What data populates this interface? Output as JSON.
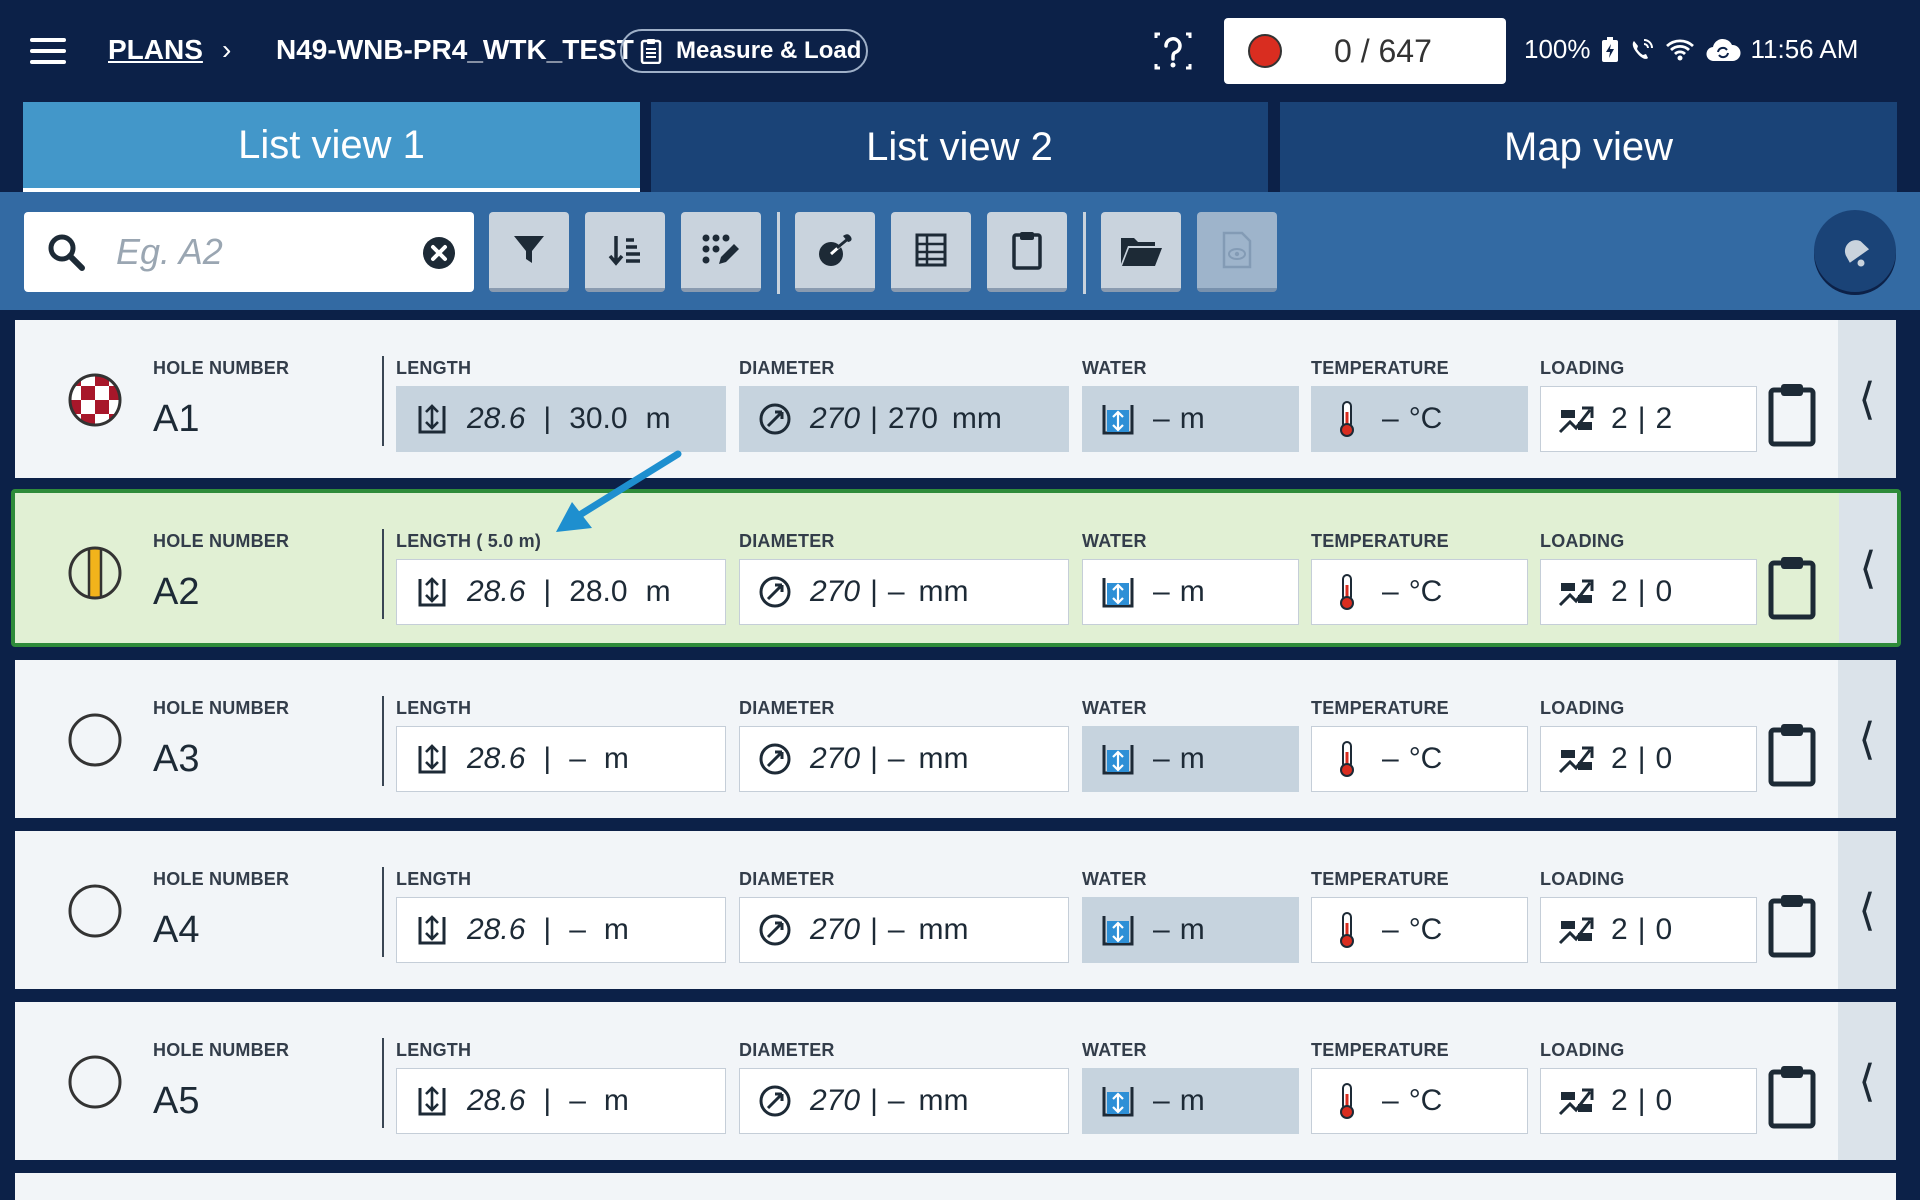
{
  "header": {
    "breadcrumb_root": "PLANS",
    "breadcrumb_sep": "›",
    "plan_name": "N49-WNB-PR4_WTK_TEST",
    "mode_label": "Measure & Load",
    "counter": "0 / 647",
    "battery": "100%",
    "time": "11:56 AM"
  },
  "tabs": [
    {
      "label": "List view 1",
      "active": true
    },
    {
      "label": "List view 2",
      "active": false
    },
    {
      "label": "Map view",
      "active": false
    }
  ],
  "search": {
    "placeholder": "Eg. A2",
    "value": ""
  },
  "toolbar_icons": [
    "filter-icon",
    "sort-icon",
    "grid-edit-icon",
    "stemming-icon",
    "table-icon",
    "clipboard-icon",
    "folder-icon",
    "document-view-icon",
    "bell-icon"
  ],
  "labels": {
    "hole_number": "HOLE NUMBER",
    "length": "LENGTH",
    "diameter": "DIAMETER",
    "water": "WATER",
    "temperature": "TEMPERATURE",
    "loading": "LOADING"
  },
  "rows": [
    {
      "status": "checkered",
      "hole": "A1",
      "length_label": "LENGTH",
      "length_plan": "28.6",
      "length_meas": "30.0",
      "length_unit": "m",
      "diam_plan": "270",
      "diam_meas": "270",
      "diam_unit": "mm",
      "water": "–",
      "water_unit": "m",
      "temp": "–",
      "temp_unit": "°C",
      "load_plan": "2",
      "load_meas": "2"
    },
    {
      "status": "half-yellow",
      "hole": "A2",
      "length_label": "LENGTH ( 5.0 m)",
      "length_plan": "28.6",
      "length_meas": "28.0",
      "length_unit": "m",
      "diam_plan": "270",
      "diam_meas": "–",
      "diam_unit": "mm",
      "water": "–",
      "water_unit": "m",
      "temp": "–",
      "temp_unit": "°C",
      "load_plan": "2",
      "load_meas": "0"
    },
    {
      "status": "empty",
      "hole": "A3",
      "length_label": "LENGTH",
      "length_plan": "28.6",
      "length_meas": "–",
      "length_unit": "m",
      "diam_plan": "270",
      "diam_meas": "–",
      "diam_unit": "mm",
      "water": "–",
      "water_unit": "m",
      "temp": "–",
      "temp_unit": "°C",
      "load_plan": "2",
      "load_meas": "0"
    },
    {
      "status": "empty",
      "hole": "A4",
      "length_label": "LENGTH",
      "length_plan": "28.6",
      "length_meas": "–",
      "length_unit": "m",
      "diam_plan": "270",
      "diam_meas": "–",
      "diam_unit": "mm",
      "water": "–",
      "water_unit": "m",
      "temp": "–",
      "temp_unit": "°C",
      "load_plan": "2",
      "load_meas": "0"
    },
    {
      "status": "empty",
      "hole": "A5",
      "length_label": "LENGTH",
      "length_plan": "28.6",
      "length_meas": "–",
      "length_unit": "m",
      "diam_plan": "270",
      "diam_meas": "–",
      "diam_unit": "mm",
      "water": "–",
      "water_unit": "m",
      "temp": "–",
      "temp_unit": "°C",
      "load_plan": "2",
      "load_meas": "0"
    }
  ],
  "colors": {
    "navy": "#0c2148",
    "active_tab": "#4397c9",
    "selected_row": "#e1f0d4",
    "selected_border": "#2e8b3a",
    "record": "#d92d20",
    "annotation_arrow": "#1e8fcf"
  }
}
